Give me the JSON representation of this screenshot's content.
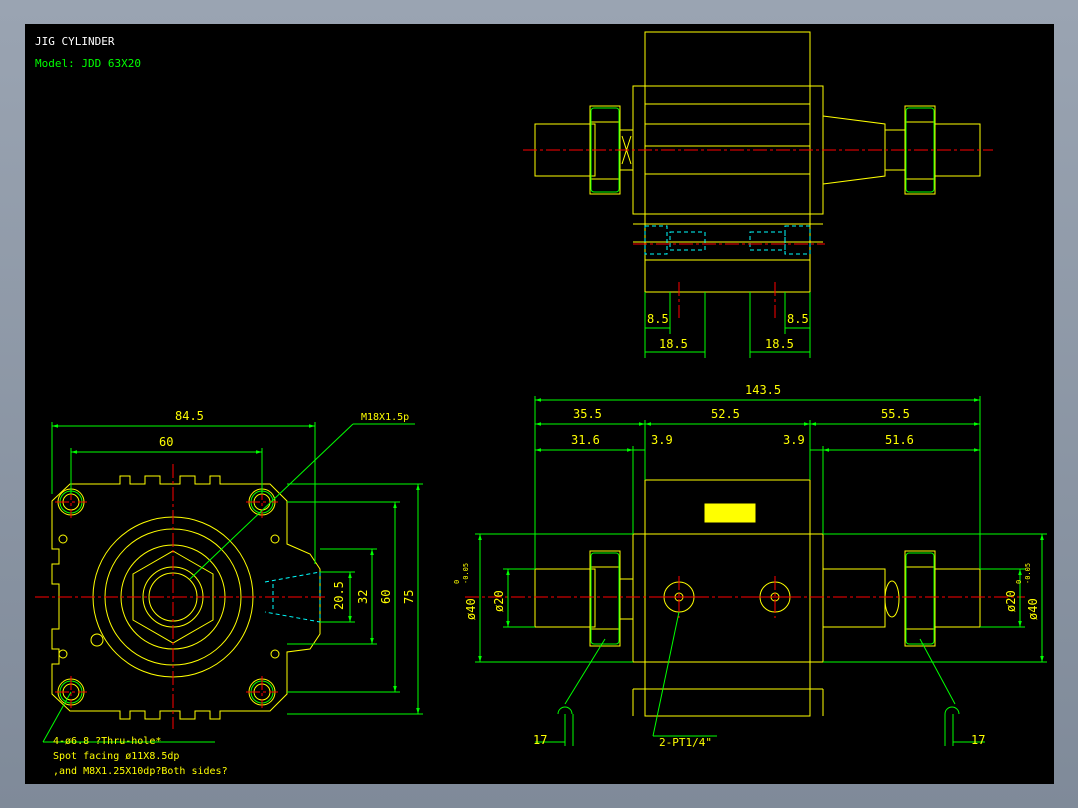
{
  "drawing": {
    "title": "JIG CYLINDER",
    "model": "Model: JDD 63X20"
  },
  "dimensions": {
    "front_width_outer": "84.5",
    "front_width_inner": "60",
    "front_h1": "20.5",
    "front_h2": "32",
    "front_h3": "60",
    "front_h4": "75",
    "thread_label": "M18X1.5p",
    "hole_note_1": "4-ø6.8 ?Thru-hole*",
    "hole_note_2": "Spot facing ø11X8.5dp",
    "hole_note_3": ",and M8X1.25X10dp?Both sides?",
    "top_a": "8.5",
    "top_b": "8.5",
    "top_c": "18.5",
    "top_d": "18.5",
    "total": "143.5",
    "seg1": "35.5",
    "seg2": "52.5",
    "seg3": "55.5",
    "sub1": "31.6",
    "sub2": "3.9",
    "sub3": "3.9",
    "sub4": "51.6",
    "dia_left_outer": "ø40",
    "dia_left_inner": "ø20",
    "dia_right_inner": "ø20",
    "dia_right_outer": "ø40",
    "tol_sup": "0",
    "tol_sub": "-0.05",
    "port_label": "2-PT1/4\"",
    "wrench_left": "17",
    "wrench_right": "17"
  },
  "colors": {
    "outline": "#ffff00",
    "dimension": "#00ff00",
    "centerline": "#ff0000",
    "hidden": "#00ffff",
    "text_title": "#ffffff"
  }
}
